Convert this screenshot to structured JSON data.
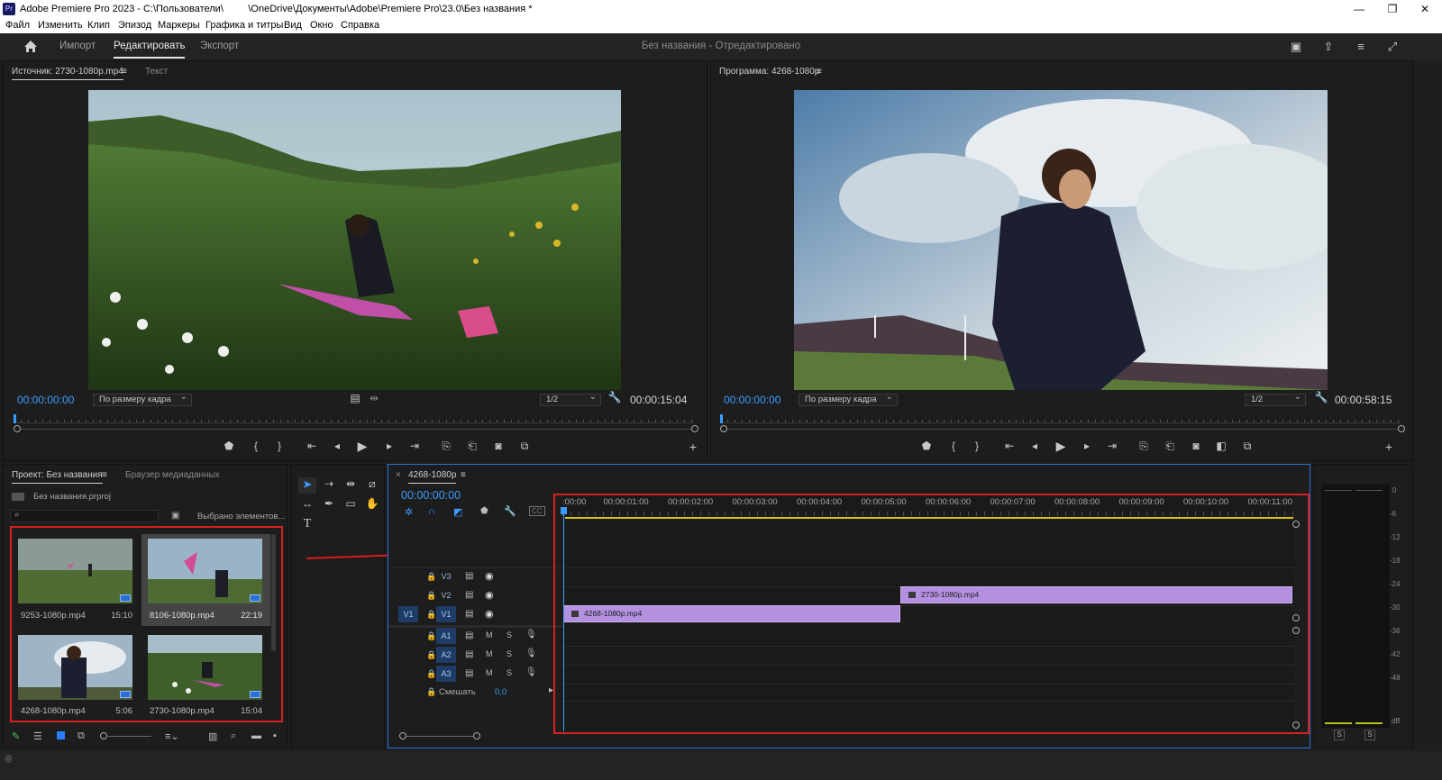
{
  "window": {
    "app_icon": "Pr",
    "title": "Adobe Premiere Pro 2023 - C:\\Пользователи\\         \\OneDrive\\Документы\\Adobe\\Premiere Pro\\23.0\\Без названия *",
    "min": "—",
    "max": "❐",
    "close": "✕"
  },
  "menu": [
    "Файл",
    "Изменить",
    "Клип",
    "Эпизод",
    "Маркеры",
    "Графика и титры",
    "Вид",
    "Окно",
    "Справка"
  ],
  "workspace": {
    "tabs": [
      "Импорт",
      "Редактировать",
      "Экспорт"
    ],
    "active": "Редактировать",
    "center_title": "Без названия",
    "center_status": "  -  Отредактировано"
  },
  "source": {
    "tab_label": "Источник: 2730-1080p.mp4",
    "tab_menu": "≡",
    "tab2": "Текст",
    "timecode": "00:00:00:00",
    "fit": "По размеру кадра",
    "resolution": "1/2",
    "duration": "00:00:15:04"
  },
  "program": {
    "tab_label": "Программа: 4268-1080p",
    "tab_menu": "≡",
    "timecode": "00:00:00:00",
    "fit": "По размеру кадра",
    "resolution": "1/2",
    "duration": "00:00:58:15"
  },
  "project": {
    "tab_label": "Проект: Без названия",
    "tab_menu": "≡",
    "tab2": "Браузер медиаданных",
    "file": "Без названия.prproj",
    "selected_text": "Выбрано элементов...",
    "items": [
      {
        "name": "9253-1080p.mp4",
        "duration": "15:10"
      },
      {
        "name": "8106-1080p.mp4",
        "duration": "22:19"
      },
      {
        "name": "4268-1080p.mp4",
        "duration": "5:06"
      },
      {
        "name": "2730-1080p.mp4",
        "duration": "15:04"
      }
    ]
  },
  "timeline": {
    "tab_close": "×",
    "tab_label": "4268-1080p",
    "tab_menu": "≡",
    "timecode": "00:00:00:00",
    "ruler": [
      ":00:00",
      "00:00:01:00",
      "00:00:02:00",
      "00:00:03:00",
      "00:00:04:00",
      "00:00:05:00",
      "00:00:06:00",
      "00:00:07:00",
      "00:00:08:00",
      "00:00:09:00",
      "00:00:10:00",
      "00:00:11:00"
    ],
    "video_tracks": [
      "V3",
      "V2",
      "V1"
    ],
    "audio_tracks": [
      "A1",
      "A2",
      "A3"
    ],
    "source_patch_v": "V1",
    "mute": "M",
    "solo": "S",
    "mix_label": "Смешать",
    "mix_value": "0,0",
    "clips": [
      {
        "name": "2730-1080p.mp4",
        "track": "V2",
        "start": 5.25,
        "end": 11.4
      },
      {
        "name": "4268-1080p.mp4",
        "track": "V1",
        "start": 0.0,
        "end": 5.25
      }
    ]
  },
  "meter": {
    "scale": [
      "0",
      "-6",
      "-12",
      "-18",
      "-24",
      "-30",
      "-36",
      "-42",
      "-48",
      "dB"
    ],
    "solo_left": "S",
    "solo_right": "S"
  },
  "colors": {
    "accent": "#3b9cff",
    "clip": "#b391e0",
    "highlight_red": "#d61f1f"
  }
}
